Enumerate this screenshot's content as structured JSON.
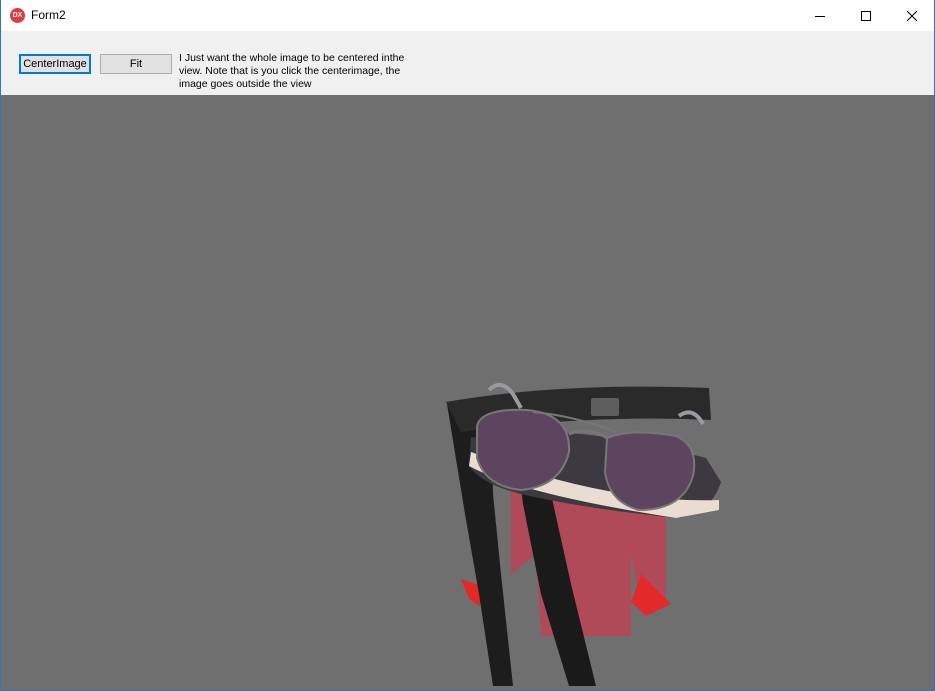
{
  "window": {
    "title": "Form2",
    "app_icon_label": "DX",
    "controls": {
      "minimize": "minimize",
      "maximize": "maximize",
      "close": "close"
    }
  },
  "toolbar": {
    "center_image_label": "CenterImage",
    "fit_label": "Fit",
    "note": "I Just want the whole image to be centered inthe view. Note that is you click the centerimage, the image goes outside the view"
  },
  "viewport": {
    "background_color": "#6f6f6f"
  }
}
